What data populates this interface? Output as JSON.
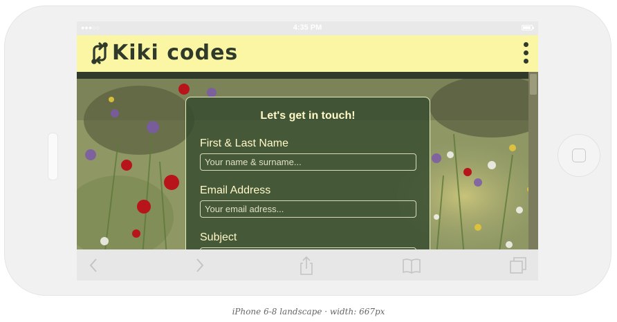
{
  "status_bar": {
    "signal": "●●●○○",
    "time": "4:35 PM"
  },
  "header": {
    "brand": "Kiki codes",
    "logo_icon": "sync-arrows-icon",
    "menu_icon": "more-vertical-icon"
  },
  "form": {
    "title": "Let's get in touch!",
    "fields": [
      {
        "label": "First & Last Name",
        "placeholder": "Your name & surname..."
      },
      {
        "label": "Email Address",
        "placeholder": "Your email adress..."
      },
      {
        "label": "Subject",
        "placeholder": ""
      }
    ]
  },
  "toolbar": {
    "icons": [
      "back-icon",
      "forward-icon",
      "share-icon",
      "bookmarks-icon",
      "tabs-icon"
    ]
  },
  "caption": "iPhone 6-8 landscape · width: 667px",
  "colors": {
    "header_bg": "#fbf6a4",
    "brand_text": "#2f3a2b",
    "card_bg": "#344a2e",
    "card_text": "#fff8c8"
  }
}
